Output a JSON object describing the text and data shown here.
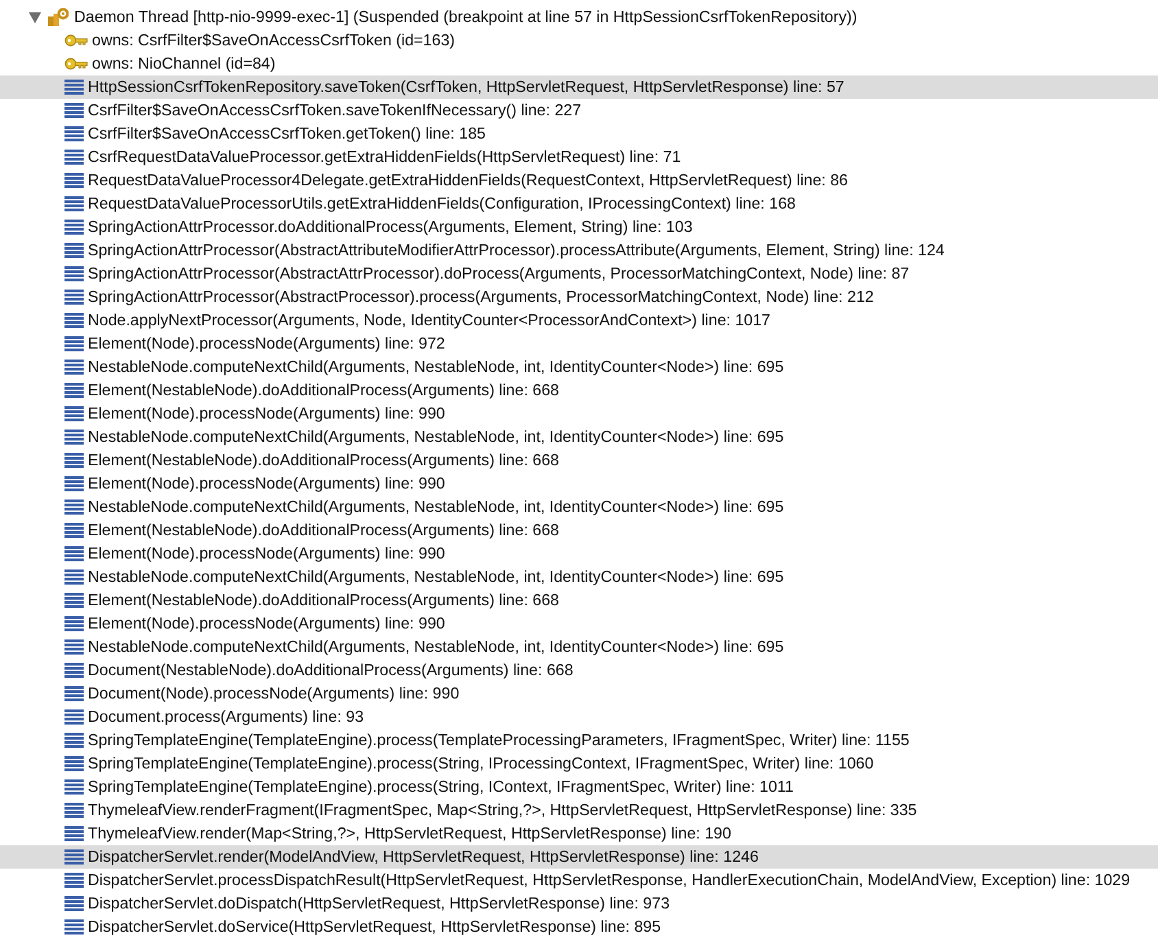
{
  "thread": {
    "label": "Daemon Thread [http-nio-9999-exec-1] (Suspended (breakpoint at line 57 in HttpSessionCsrfTokenRepository))",
    "expanded": true
  },
  "monitors": [
    {
      "label": "owns: CsrfFilter$SaveOnAccessCsrfToken  (id=163)"
    },
    {
      "label": "owns: NioChannel  (id=84)"
    }
  ],
  "frames": [
    {
      "label": "HttpSessionCsrfTokenRepository.saveToken(CsrfToken, HttpServletRequest, HttpServletResponse) line: 57",
      "selected": true
    },
    {
      "label": "CsrfFilter$SaveOnAccessCsrfToken.saveTokenIfNecessary() line: 227",
      "selected": false
    },
    {
      "label": "CsrfFilter$SaveOnAccessCsrfToken.getToken() line: 185",
      "selected": false
    },
    {
      "label": "CsrfRequestDataValueProcessor.getExtraHiddenFields(HttpServletRequest) line: 71",
      "selected": false
    },
    {
      "label": "RequestDataValueProcessor4Delegate.getExtraHiddenFields(RequestContext, HttpServletRequest) line: 86",
      "selected": false
    },
    {
      "label": "RequestDataValueProcessorUtils.getExtraHiddenFields(Configuration, IProcessingContext) line: 168",
      "selected": false
    },
    {
      "label": "SpringActionAttrProcessor.doAdditionalProcess(Arguments, Element, String) line: 103",
      "selected": false
    },
    {
      "label": "SpringActionAttrProcessor(AbstractAttributeModifierAttrProcessor).processAttribute(Arguments, Element, String) line: 124",
      "selected": false
    },
    {
      "label": "SpringActionAttrProcessor(AbstractAttrProcessor).doProcess(Arguments, ProcessorMatchingContext, Node) line: 87",
      "selected": false
    },
    {
      "label": "SpringActionAttrProcessor(AbstractProcessor).process(Arguments, ProcessorMatchingContext, Node) line: 212",
      "selected": false
    },
    {
      "label": "Node.applyNextProcessor(Arguments, Node, IdentityCounter<ProcessorAndContext>) line: 1017",
      "selected": false
    },
    {
      "label": "Element(Node).processNode(Arguments) line: 972",
      "selected": false
    },
    {
      "label": "NestableNode.computeNextChild(Arguments, NestableNode, int, IdentityCounter<Node>) line: 695",
      "selected": false
    },
    {
      "label": "Element(NestableNode).doAdditionalProcess(Arguments) line: 668",
      "selected": false
    },
    {
      "label": "Element(Node).processNode(Arguments) line: 990",
      "selected": false
    },
    {
      "label": "NestableNode.computeNextChild(Arguments, NestableNode, int, IdentityCounter<Node>) line: 695",
      "selected": false
    },
    {
      "label": "Element(NestableNode).doAdditionalProcess(Arguments) line: 668",
      "selected": false
    },
    {
      "label": "Element(Node).processNode(Arguments) line: 990",
      "selected": false
    },
    {
      "label": "NestableNode.computeNextChild(Arguments, NestableNode, int, IdentityCounter<Node>) line: 695",
      "selected": false
    },
    {
      "label": "Element(NestableNode).doAdditionalProcess(Arguments) line: 668",
      "selected": false
    },
    {
      "label": "Element(Node).processNode(Arguments) line: 990",
      "selected": false
    },
    {
      "label": "NestableNode.computeNextChild(Arguments, NestableNode, int, IdentityCounter<Node>) line: 695",
      "selected": false
    },
    {
      "label": "Element(NestableNode).doAdditionalProcess(Arguments) line: 668",
      "selected": false
    },
    {
      "label": "Element(Node).processNode(Arguments) line: 990",
      "selected": false
    },
    {
      "label": "NestableNode.computeNextChild(Arguments, NestableNode, int, IdentityCounter<Node>) line: 695",
      "selected": false
    },
    {
      "label": "Document(NestableNode).doAdditionalProcess(Arguments) line: 668",
      "selected": false
    },
    {
      "label": "Document(Node).processNode(Arguments) line: 990",
      "selected": false
    },
    {
      "label": "Document.process(Arguments) line: 93",
      "selected": false
    },
    {
      "label": "SpringTemplateEngine(TemplateEngine).process(TemplateProcessingParameters, IFragmentSpec, Writer) line: 1155",
      "selected": false
    },
    {
      "label": "SpringTemplateEngine(TemplateEngine).process(String, IProcessingContext, IFragmentSpec, Writer) line: 1060",
      "selected": false
    },
    {
      "label": "SpringTemplateEngine(TemplateEngine).process(String, IContext, IFragmentSpec, Writer) line: 1011",
      "selected": false
    },
    {
      "label": "ThymeleafView.renderFragment(IFragmentSpec, Map<String,?>, HttpServletRequest, HttpServletResponse) line: 335",
      "selected": false
    },
    {
      "label": "ThymeleafView.render(Map<String,?>, HttpServletRequest, HttpServletResponse) line: 190",
      "selected": false
    },
    {
      "label": "DispatcherServlet.render(ModelAndView, HttpServletRequest, HttpServletResponse) line: 1246",
      "selected": true
    },
    {
      "label": "DispatcherServlet.processDispatchResult(HttpServletRequest, HttpServletResponse, HandlerExecutionChain, ModelAndView, Exception) line: 1029",
      "selected": false
    },
    {
      "label": "DispatcherServlet.doDispatch(HttpServletRequest, HttpServletResponse) line: 973",
      "selected": false
    },
    {
      "label": "DispatcherServlet.doService(HttpServletRequest, HttpServletResponse) line: 895",
      "selected": false
    }
  ]
}
